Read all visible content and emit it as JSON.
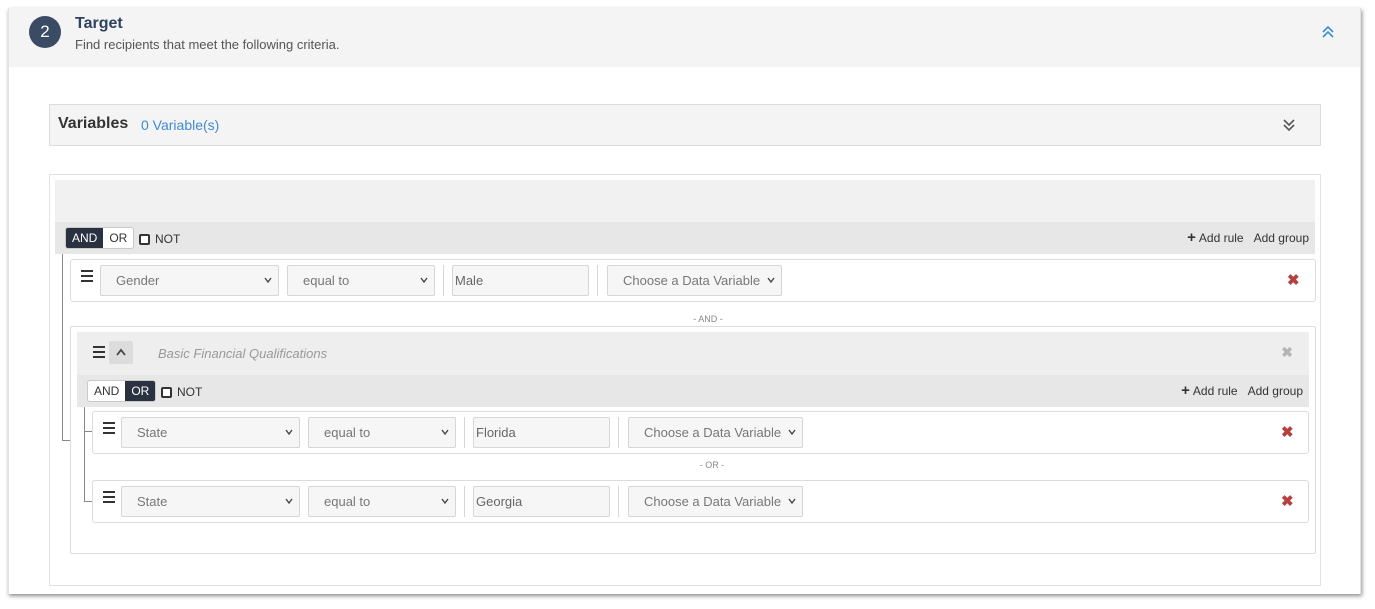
{
  "step": {
    "number": "2",
    "title": "Target",
    "subtitle": "Find recipients that meet the following criteria."
  },
  "variables": {
    "title": "Variables",
    "count_label": "0 Variable(s)"
  },
  "root_group": {
    "and_label": "AND",
    "or_label": "OR",
    "not_label": "NOT",
    "active": "AND",
    "add_rule": "Add rule",
    "add_group": "Add group",
    "rules": [
      {
        "field": "Gender",
        "operator": "equal to",
        "value": "Male",
        "data_variable": "Choose a Data Variable"
      }
    ],
    "conjunction": "- AND -"
  },
  "sub_group": {
    "name": "Basic Financial Qualifications",
    "and_label": "AND",
    "or_label": "OR",
    "not_label": "NOT",
    "active": "OR",
    "add_rule": "Add rule",
    "add_group": "Add group",
    "rules": [
      {
        "field": "State",
        "operator": "equal to",
        "value": "Florida",
        "data_variable": "Choose a Data Variable"
      },
      {
        "field": "State",
        "operator": "equal to",
        "value": "Georgia",
        "data_variable": "Choose a Data Variable"
      }
    ],
    "conjunction": "- OR -"
  },
  "icons": {
    "collapse": "chevron-double-up-icon",
    "expand": "chevron-double-down-icon",
    "drag": "drag-handle-icon",
    "delete": "delete-x-icon",
    "plus": "plus-icon"
  },
  "colors": {
    "accent": "#3e8bd3",
    "step_circle": "#3b4b63",
    "active_toggle": "#2a3242",
    "delete": "#b54040"
  }
}
